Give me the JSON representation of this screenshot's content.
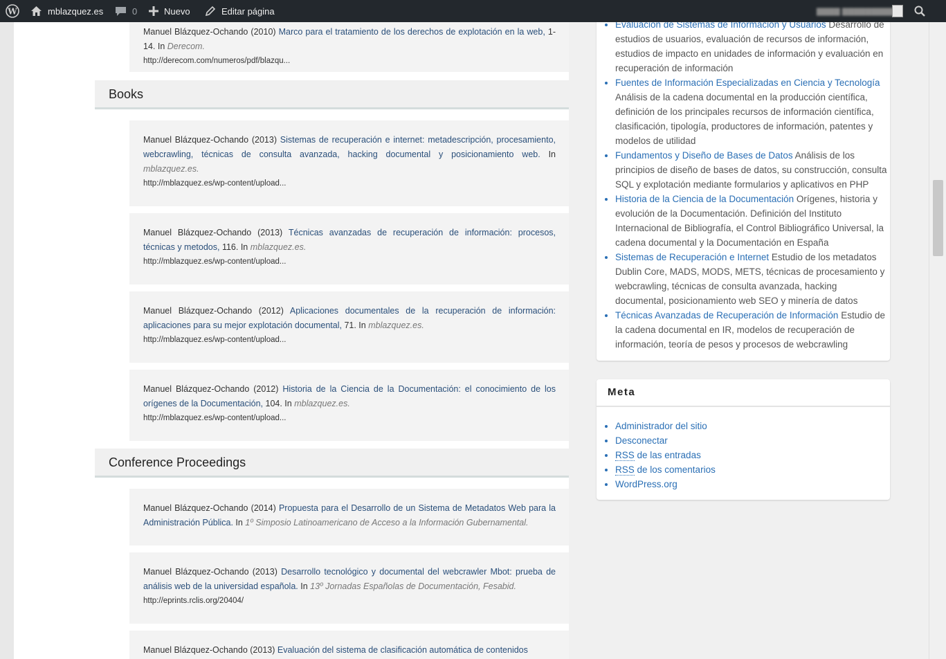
{
  "adminbar": {
    "site_name": "mblazquez.es",
    "comments_count": "0",
    "new_label": "Nuevo",
    "edit_label": "Editar página",
    "user_name": "▇▇▇▇ ▇▇▇▇▇▇▇▇▇"
  },
  "main": {
    "top_card": {
      "author": "Manuel Blázquez-Ochando (2010) ",
      "title": "Marco para el tratamiento de los derechos de explotación en la web,",
      "pages": " 1-14. In ",
      "venue": "Derecom.",
      "url": "http://derecom.com/numeros/pdf/blazqu..."
    },
    "books_heading": "Books",
    "books": [
      {
        "author": "Manuel Blázquez-Ochando (2013) ",
        "title": "Sistemas de recuperación e internet: metadescripción, procesamiento, webcrawling, técnicas de consulta avanzada, hacking documental y posicionamiento web.",
        "pages": " In ",
        "venue": "mblazquez.es.",
        "url": "http://mblazquez.es/wp-content/upload..."
      },
      {
        "author": "Manuel Blázquez-Ochando (2013) ",
        "title": "Técnicas avanzadas de recuperación de información: procesos, técnicas y metodos,",
        "pages": " 116. In ",
        "venue": "mblazquez.es.",
        "url": "http://mblazquez.es/wp-content/upload..."
      },
      {
        "author": "Manuel Blázquez-Ochando (2012) ",
        "title": "Aplicaciones documentales de la recuperación de información: aplicaciones para su mejor explotación documental,",
        "pages": " 71. In ",
        "venue": "mblazquez.es.",
        "url": "http://mblazquez.es/wp-content/upload..."
      },
      {
        "author": "Manuel Blázquez-Ochando (2012) ",
        "title": "Historia de la Ciencia de la Documentación: el conocimiento de los orígenes de la Documentación,",
        "pages": " 104. In ",
        "venue": "mblazquez.es.",
        "url": "http://mblazquez.es/wp-content/upload..."
      }
    ],
    "conf_heading": "Conference Proceedings",
    "conferences": [
      {
        "author": "Manuel Blázquez-Ochando (2014) ",
        "title": "Propuesta para el Desarrollo de un Sistema de Metadatos Web para la Administración Pública.",
        "pages": " In ",
        "venue": "1º Simposio Latinoamericano de Acceso a la Información Gubernamental.",
        "url": ""
      },
      {
        "author": "Manuel Blázquez-Ochando (2013) ",
        "title": "Desarrollo tecnológico y documental del webcrawler Mbot: prueba de análisis web de la universidad española.",
        "pages": " In ",
        "venue": "13º Jornadas Españolas de Documentación, Fesabid.",
        "url": "http://eprints.rclis.org/20404/"
      },
      {
        "author": "Manuel Blázquez-Ochando (2013) ",
        "title": "Evaluación del sistema de clasificación automática de contenidos",
        "pages": "",
        "venue": "",
        "url": ""
      }
    ]
  },
  "sidebar": {
    "courses": [
      {
        "link": "Evaluación de Sistemas de Información y Usuarios",
        "desc": " Desarrollo de estudios de usuarios, evaluación de recursos de información, estudios de impacto en unidades de información y evaluación en recuperación de información"
      },
      {
        "link": "Fuentes de Información Especializadas en Ciencia y Tecnología",
        "desc": " Análisis de la cadena documental en la producción científica, definición de los principales recursos de información científica, clasificación, tipología, productores de información, patentes y modelos de utilidad"
      },
      {
        "link": "Fundamentos y Diseño de Bases de Datos",
        "desc": " Análisis de los principios de diseño de bases de datos, su construcción, consulta SQL y explotación mediante formularios y aplicativos en PHP"
      },
      {
        "link": "Historia de la Ciencia de la Documentación",
        "desc": " Orígenes, historia y evolución de la Documentación. Definición del Instituto Internacional de Bibliografía, el Control Bibliográfico Universal, la cadena documental y la Documentación en España"
      },
      {
        "link": "Sistemas de Recuperación e Internet",
        "desc": " Estudio de los metadatos Dublin Core, MADS, MODS, METS, técnicas de procesamiento y webcrawling, técnicas de consulta avanzada, hacking documental, posicionamiento web SEO y minería de datos"
      },
      {
        "link": "Técnicas Avanzadas de Recuperación de Información",
        "desc": " Estudio de la cadena documental en IR, modelos de recuperación de información, teoría de pesos y procesos de webcrawling"
      }
    ],
    "meta": {
      "title": "Meta",
      "admin": "Administrador del sitio",
      "logout": "Desconectar",
      "rss": "RSS",
      "rss_entries_rest": " de las entradas",
      "rss_comments_rest": " de los comentarios",
      "wordpress": "WordPress.org"
    }
  }
}
